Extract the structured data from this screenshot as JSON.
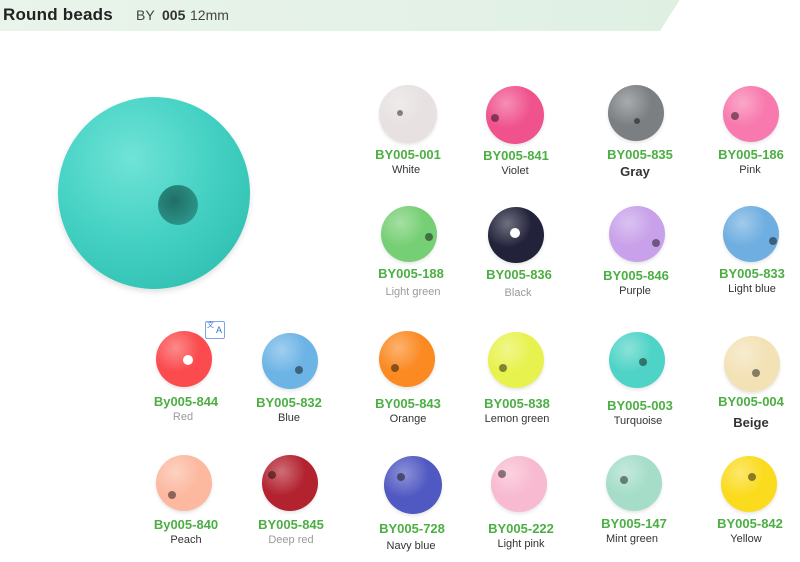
{
  "header": {
    "title": "Round beads",
    "code_prefix": "BY",
    "code_number": "005",
    "size": "12mm"
  },
  "beads": [
    {
      "code": "BY005-001",
      "name": "White",
      "color": "#e7e1e1"
    },
    {
      "code": "BY005-841",
      "name": "Violet",
      "color": "#f0528d"
    },
    {
      "code": "BY005-835",
      "name": "Gray",
      "color": "#7b7f82"
    },
    {
      "code": "BY005-186",
      "name": "Pink",
      "color": "#f879ad"
    },
    {
      "code": "BY005-188",
      "name": "Light green",
      "color": "#76cf74"
    },
    {
      "code": "BY005-836",
      "name": "Black",
      "color": "#22233a"
    },
    {
      "code": "BY005-846",
      "name": "Purple",
      "color": "#c8a1ea"
    },
    {
      "code": "BY005-833",
      "name": "Light blue",
      "color": "#6eaee0"
    },
    {
      "code": "By005-844",
      "name": "Red",
      "color": "#fb4b4e"
    },
    {
      "code": "BY005-832",
      "name": "Blue",
      "color": "#6db4e6"
    },
    {
      "code": "BY005-843",
      "name": "Orange",
      "color": "#fb8a23"
    },
    {
      "code": "BY005-838",
      "name": "Lemon green",
      "color": "#e8f24e"
    },
    {
      "code": "BY005-003",
      "name": "Turquoise",
      "color": "#4ed3c6"
    },
    {
      "code": "BY005-004",
      "name": "Beige",
      "color": "#f3e2b6"
    },
    {
      "code": "By005-840",
      "name": "Peach",
      "color": "#fcb9a0"
    },
    {
      "code": "BY005-845",
      "name": "Deep red",
      "color": "#b3222f"
    },
    {
      "code": "BY005-728",
      "name": "Navy blue",
      "color": "#5058c2"
    },
    {
      "code": "BY005-222",
      "name": "Light pink",
      "color": "#f8bad0"
    },
    {
      "code": "BY005-147",
      "name": "Mint green",
      "color": "#a5ddc9"
    },
    {
      "code": "BY005-842",
      "name": "Yellow",
      "color": "#fbdb1e"
    }
  ],
  "icons": {
    "translate": "translate-icon"
  }
}
